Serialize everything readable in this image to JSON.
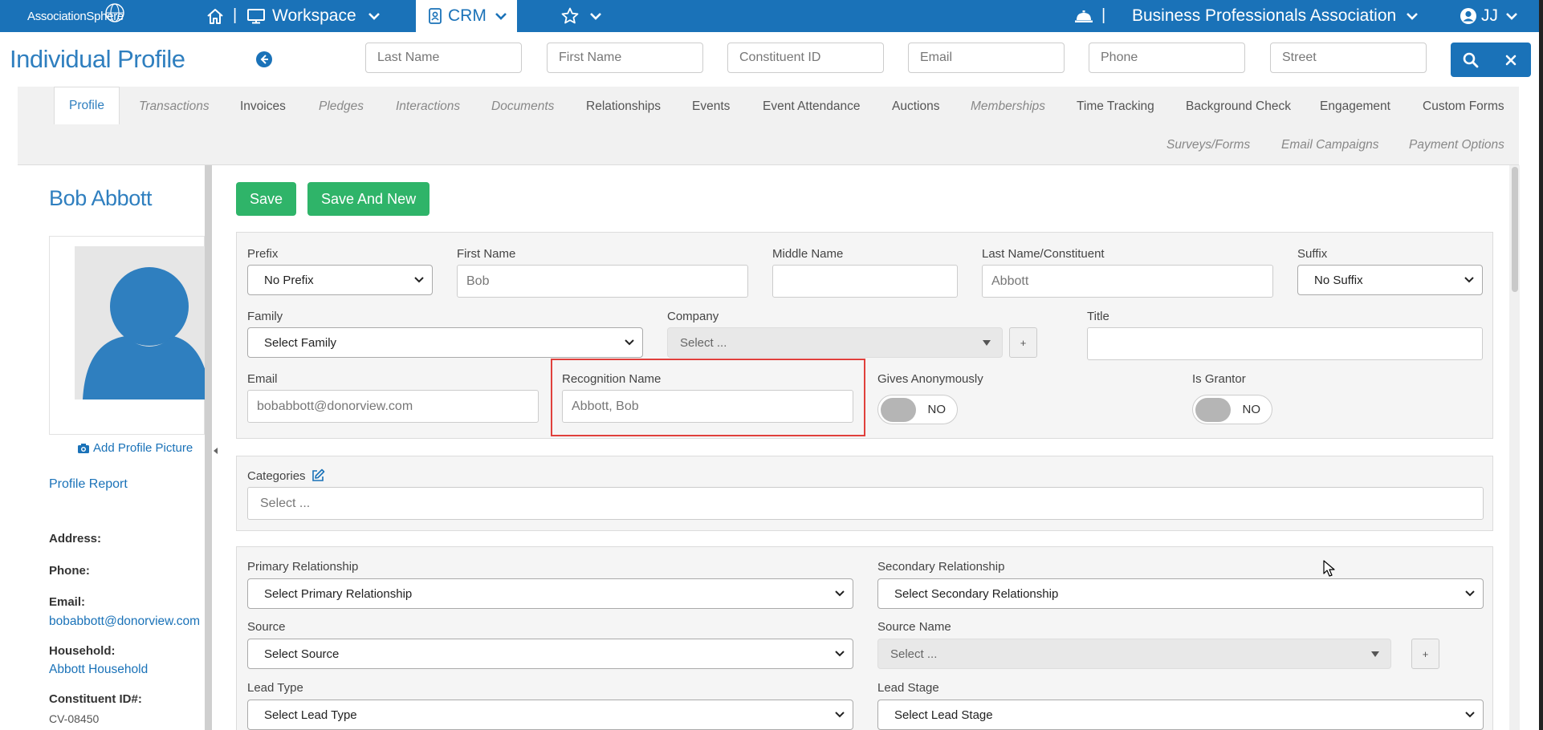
{
  "topnav": {
    "logo": "AssociationSphere",
    "workspace": "Workspace",
    "crm": "CRM",
    "org": "Business Professionals Association",
    "user": "JJ",
    "sep": "|"
  },
  "header": {
    "title": "Individual Profile",
    "search": {
      "last_name": "Last Name",
      "first_name": "First Name",
      "constituent_id": "Constituent ID",
      "email": "Email",
      "phone": "Phone",
      "street": "Street"
    }
  },
  "tabs": {
    "profile": "Profile",
    "transactions": "Transactions",
    "invoices": "Invoices",
    "pledges": "Pledges",
    "interactions": "Interactions",
    "documents": "Documents",
    "relationships": "Relationships",
    "events": "Events",
    "event_attendance": "Event Attendance",
    "auctions": "Auctions",
    "memberships": "Memberships",
    "time_tracking": "Time Tracking",
    "background_check": "Background Check",
    "engagement": "Engagement",
    "custom_forms": "Custom Forms",
    "surveys_forms": "Surveys/Forms",
    "email_campaigns": "Email Campaigns",
    "payment_options": "Payment Options"
  },
  "left_panel": {
    "name": "Bob Abbott",
    "add_picture": "Add Profile Picture",
    "profile_report": "Profile Report",
    "address_label": "Address:",
    "phone_label": "Phone:",
    "email_label": "Email:",
    "email_value": "bobabbott@donorview.com",
    "household_label": "Household:",
    "household_value": "Abbott Household",
    "constituent_label": "Constituent ID#:",
    "constituent_value": "CV-08450"
  },
  "actions": {
    "save": "Save",
    "save_and_new": "Save And New"
  },
  "form": {
    "prefix_label": "Prefix",
    "prefix_value": "No Prefix",
    "first_name_label": "First Name",
    "first_name_value": "Bob",
    "middle_name_label": "Middle Name",
    "middle_name_value": "",
    "last_name_label": "Last Name/Constituent",
    "last_name_value": "Abbott",
    "suffix_label": "Suffix",
    "suffix_value": "No Suffix",
    "family_label": "Family",
    "family_value": "Select Family",
    "company_label": "Company",
    "company_value": "Select ...",
    "plus": "+",
    "title_label": "Title",
    "title_value": "",
    "email_label": "Email",
    "email_value": "bobabbott@donorview.com",
    "recognition_label": "Recognition Name",
    "recognition_value": "Abbott, Bob",
    "gives_anon_label": "Gives Anonymously",
    "gives_anon_value": "NO",
    "grantor_label": "Is Grantor",
    "grantor_value": "NO",
    "categories_label": "Categories",
    "categories_value": "Select ...",
    "primary_rel_label": "Primary Relationship",
    "primary_rel_value": "Select Primary Relationship",
    "secondary_rel_label": "Secondary Relationship",
    "secondary_rel_value": "Select Secondary Relationship",
    "source_label": "Source",
    "source_value": "Select Source",
    "source_name_label": "Source Name",
    "source_name_value": "Select ...",
    "lead_type_label": "Lead Type",
    "lead_type_value": "Select Lead Type",
    "lead_stage_label": "Lead Stage",
    "lead_stage_value": "Select Lead Stage"
  }
}
